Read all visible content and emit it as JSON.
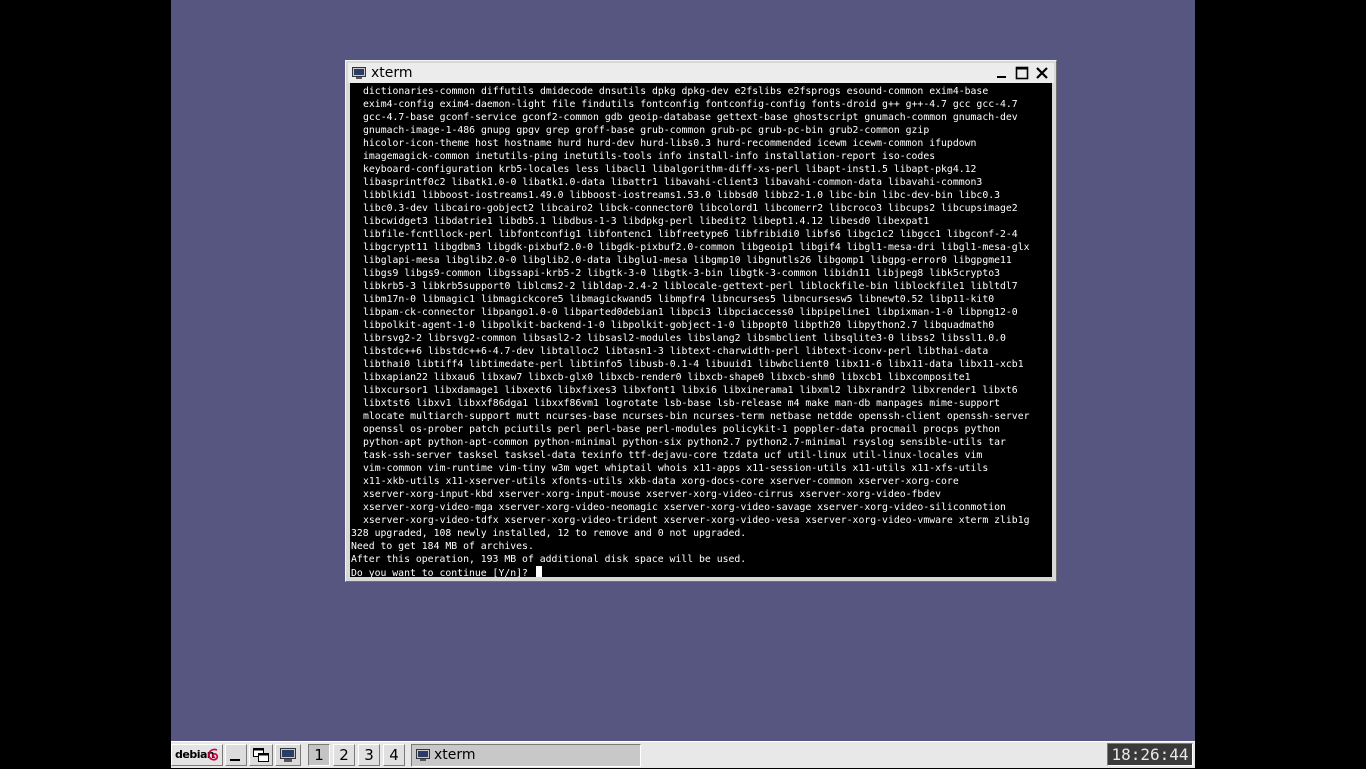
{
  "window": {
    "title": "xterm"
  },
  "terminal": {
    "package_lines": [
      "dictionaries-common diffutils dmidecode dnsutils dpkg dpkg-dev e2fslibs e2fsprogs esound-common exim4-base",
      "exim4-config exim4-daemon-light file findutils fontconfig fontconfig-config fonts-droid g++ g++-4.7 gcc gcc-4.7",
      "gcc-4.7-base gconf-service gconf2-common gdb geoip-database gettext-base ghostscript gnumach-common gnumach-dev",
      "gnumach-image-1-486 gnupg gpgv grep groff-base grub-common grub-pc grub-pc-bin grub2-common gzip",
      "hicolor-icon-theme host hostname hurd hurd-dev hurd-libs0.3 hurd-recommended icewm icewm-common ifupdown",
      "imagemagick-common inetutils-ping inetutils-tools info install-info installation-report iso-codes",
      "keyboard-configuration krb5-locales less libacl1 libalgorithm-diff-xs-perl libapt-inst1.5 libapt-pkg4.12",
      "libasprintf0c2 libatk1.0-0 libatk1.0-data libattr1 libavahi-client3 libavahi-common-data libavahi-common3",
      "libblkid1 libboost-iostreams1.49.0 libboost-iostreams1.53.0 libbsd0 libbz2-1.0 libc-bin libc-dev-bin libc0.3",
      "libc0.3-dev libcairo-gobject2 libcairo2 libck-connector0 libcolord1 libcomerr2 libcroco3 libcups2 libcupsimage2",
      "libcwidget3 libdatrie1 libdb5.1 libdbus-1-3 libdpkg-perl libedit2 libept1.4.12 libesd0 libexpat1",
      "libfile-fcntllock-perl libfontconfig1 libfontenc1 libfreetype6 libfribidi0 libfs6 libgc1c2 libgcc1 libgconf-2-4",
      "libgcrypt11 libgdbm3 libgdk-pixbuf2.0-0 libgdk-pixbuf2.0-common libgeoip1 libgif4 libgl1-mesa-dri libgl1-mesa-glx",
      "libglapi-mesa libglib2.0-0 libglib2.0-data libglu1-mesa libgmp10 libgnutls26 libgomp1 libgpg-error0 libgpgme11",
      "libgs9 libgs9-common libgssapi-krb5-2 libgtk-3-0 libgtk-3-bin libgtk-3-common libidn11 libjpeg8 libk5crypto3",
      "libkrb5-3 libkrb5support0 liblcms2-2 libldap-2.4-2 liblocale-gettext-perl liblockfile-bin liblockfile1 libltdl7",
      "libm17n-0 libmagic1 libmagickcore5 libmagickwand5 libmpfr4 libncurses5 libncursesw5 libnewt0.52 libp11-kit0",
      "libpam-ck-connector libpango1.0-0 libparted0debian1 libpci3 libpciaccess0 libpipeline1 libpixman-1-0 libpng12-0",
      "libpolkit-agent-1-0 libpolkit-backend-1-0 libpolkit-gobject-1-0 libpopt0 libpth20 libpython2.7 libquadmath0",
      "librsvg2-2 librsvg2-common libsasl2-2 libsasl2-modules libslang2 libsmbclient libsqlite3-0 libss2 libssl1.0.0",
      "libstdc++6 libstdc++6-4.7-dev libtalloc2 libtasn1-3 libtext-charwidth-perl libtext-iconv-perl libthai-data",
      "libthai0 libtiff4 libtimedate-perl libtinfo5 libusb-0.1-4 libuuid1 libwbclient0 libx11-6 libx11-data libx11-xcb1",
      "libxapian22 libxau6 libxaw7 libxcb-glx0 libxcb-render0 libxcb-shape0 libxcb-shm0 libxcb1 libxcomposite1",
      "libxcursor1 libxdamage1 libxext6 libxfixes3 libxfont1 libxi6 libxinerama1 libxml2 libxrandr2 libxrender1 libxt6",
      "libxtst6 libxv1 libxxf86dga1 libxxf86vm1 logrotate lsb-base lsb-release m4 make man-db manpages mime-support",
      "mlocate multiarch-support mutt ncurses-base ncurses-bin ncurses-term netbase netdde openssh-client openssh-server",
      "openssl os-prober patch pciutils perl perl-base perl-modules policykit-1 poppler-data procmail procps python",
      "python-apt python-apt-common python-minimal python-six python2.7 python2.7-minimal rsyslog sensible-utils tar",
      "task-ssh-server tasksel tasksel-data texinfo ttf-dejavu-core tzdata ucf util-linux util-linux-locales vim",
      "vim-common vim-runtime vim-tiny w3m wget whiptail whois x11-apps x11-session-utils x11-utils x11-xfs-utils",
      "x11-xkb-utils x11-xserver-utils xfonts-utils xkb-data xorg-docs-core xserver-common xserver-xorg-core",
      "xserver-xorg-input-kbd xserver-xorg-input-mouse xserver-xorg-video-cirrus xserver-xorg-video-fbdev",
      "xserver-xorg-video-mga xserver-xorg-video-neomagic xserver-xorg-video-savage xserver-xorg-video-siliconmotion",
      "xserver-xorg-video-tdfx xserver-xorg-video-trident xserver-xorg-video-vesa xserver-xorg-video-vmware xterm zlib1g"
    ],
    "summary_lines": [
      "328 upgraded, 108 newly installed, 12 to remove and 0 not upgraded.",
      "Need to get 184 MB of archives.",
      "After this operation, 193 MB of additional disk space will be used."
    ],
    "prompt": "Do you want to continue [Y/n]? "
  },
  "taskbar": {
    "start_label": "debian",
    "start_icon": "debian-swirl-icon",
    "workspaces": [
      "1",
      "2",
      "3",
      "4"
    ],
    "active_workspace": "1",
    "task_label": "xterm",
    "clock": "18:26:44"
  }
}
